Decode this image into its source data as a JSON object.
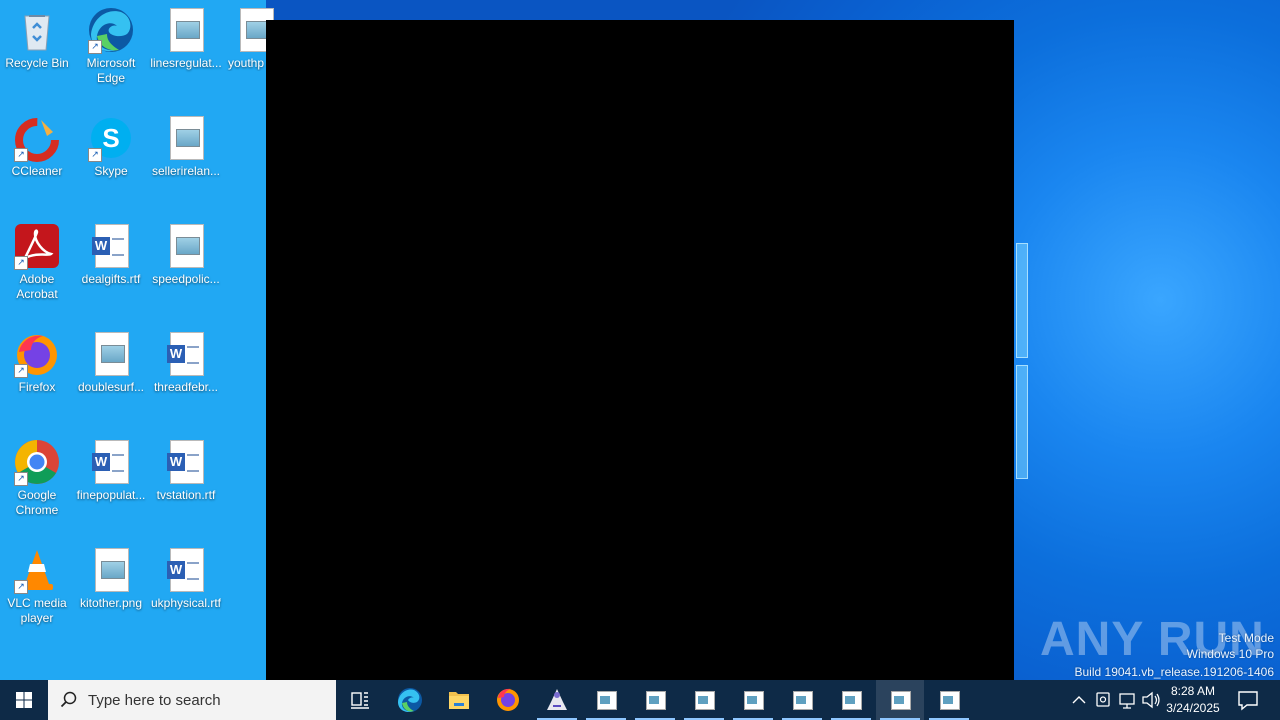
{
  "desktop_icons": [
    {
      "label": "Recycle Bin",
      "icon": "recycle-bin-icon"
    },
    {
      "label": "Microsoft Edge",
      "icon": "edge-icon"
    },
    {
      "label": "linesregulat...",
      "icon": "image-file-icon"
    },
    {
      "label": "youthp",
      "icon": "image-file-icon"
    },
    {
      "label": "CCleaner",
      "icon": "ccleaner-icon"
    },
    {
      "label": "Skype",
      "icon": "skype-icon"
    },
    {
      "label": "sellerirelan...",
      "icon": "image-file-icon"
    },
    {
      "label": "Adobe Acrobat",
      "icon": "acrobat-icon"
    },
    {
      "label": "dealgifts.rtf",
      "icon": "word-file-icon"
    },
    {
      "label": "speedpolic...",
      "icon": "image-file-icon"
    },
    {
      "label": "Firefox",
      "icon": "firefox-icon"
    },
    {
      "label": "doublesurf...",
      "icon": "image-file-icon"
    },
    {
      "label": "threadfebr...",
      "icon": "word-file-icon"
    },
    {
      "label": "Google Chrome",
      "icon": "chrome-icon"
    },
    {
      "label": "finepopulat...",
      "icon": "word-file-icon"
    },
    {
      "label": "tvstation.rtf",
      "icon": "word-file-icon"
    },
    {
      "label": "VLC media player",
      "icon": "vlc-icon"
    },
    {
      "label": "kitother.png",
      "icon": "image-file-icon"
    },
    {
      "label": "ukphysical.rtf",
      "icon": "word-file-icon"
    }
  ],
  "watermark": {
    "line1": "Test Mode",
    "line2": "Windows 10 Pro",
    "line3": "Build 19041.vb_release.191206-1406",
    "brand": "ANY RUN"
  },
  "taskbar": {
    "search_placeholder": "Type here to search",
    "clock_time": "8:28 AM",
    "clock_date": "3/24/2025",
    "pinned": [
      "task-view-icon",
      "edge-icon",
      "file-explorer-icon",
      "firefox-icon",
      "app-icon"
    ],
    "open_windows_count": 8
  },
  "colors": {
    "desktop_left_panel": "#21a8f3",
    "taskbar": "#0e2a47",
    "accent": "#8fc7ff"
  }
}
